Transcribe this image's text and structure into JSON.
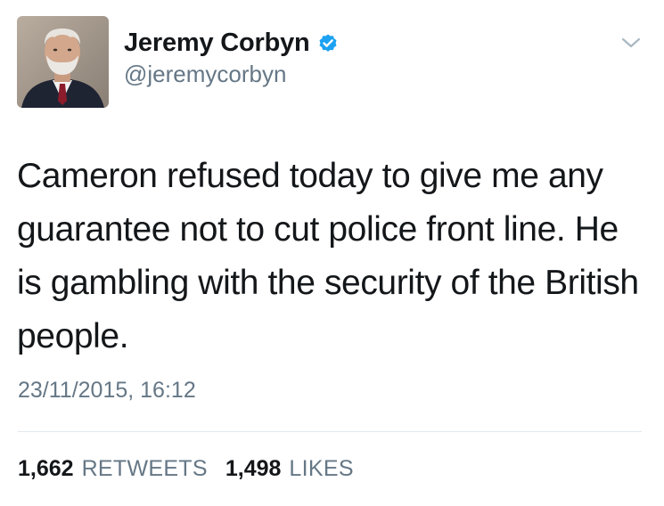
{
  "user": {
    "display_name": "Jeremy Corbyn",
    "handle": "@jeremycorbyn",
    "verified": true,
    "avatar": "profile-photo"
  },
  "tweet": {
    "text": "Cameron refused today to give me any guarantee not to cut police front line. He is gambling with the security of the British people.",
    "timestamp": "23/11/2015, 16:12"
  },
  "stats": {
    "retweets_count": "1,662",
    "retweets_label": "RETWEETS",
    "likes_count": "1,498",
    "likes_label": "LIKES"
  },
  "icons": {
    "verified": "verified-badge-icon",
    "more": "chevron-down-icon"
  },
  "colors": {
    "verified_blue": "#1da1f2",
    "secondary_text": "#657786",
    "primary_text": "#14171a",
    "divider": "#e1e8ed"
  }
}
